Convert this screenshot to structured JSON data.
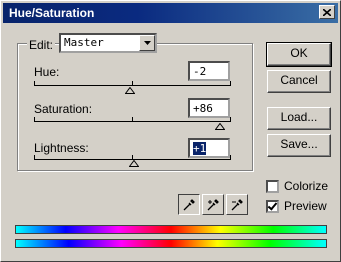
{
  "window": {
    "title": "Hue/Saturation"
  },
  "edit": {
    "label": "Edit:",
    "selected": "Master"
  },
  "sliders": {
    "hue": {
      "label": "Hue:",
      "value": "-2"
    },
    "saturation": {
      "label": "Saturation:",
      "value": "+86"
    },
    "lightness": {
      "label": "Lightness:",
      "value": "+1"
    }
  },
  "buttons": {
    "ok": "OK",
    "cancel": "Cancel",
    "load": "Load...",
    "save": "Save..."
  },
  "checkboxes": {
    "colorize": {
      "label": "Colorize",
      "checked": false
    },
    "preview": {
      "label": "Preview",
      "checked": true
    }
  },
  "eyedroppers": [
    "eyedropper-icon",
    "eyedropper-plus-icon",
    "eyedropper-minus-icon"
  ],
  "colors": {
    "titlebar": "#0a246a",
    "dialog": "#d4d0c8",
    "selection": "#0a246a"
  }
}
